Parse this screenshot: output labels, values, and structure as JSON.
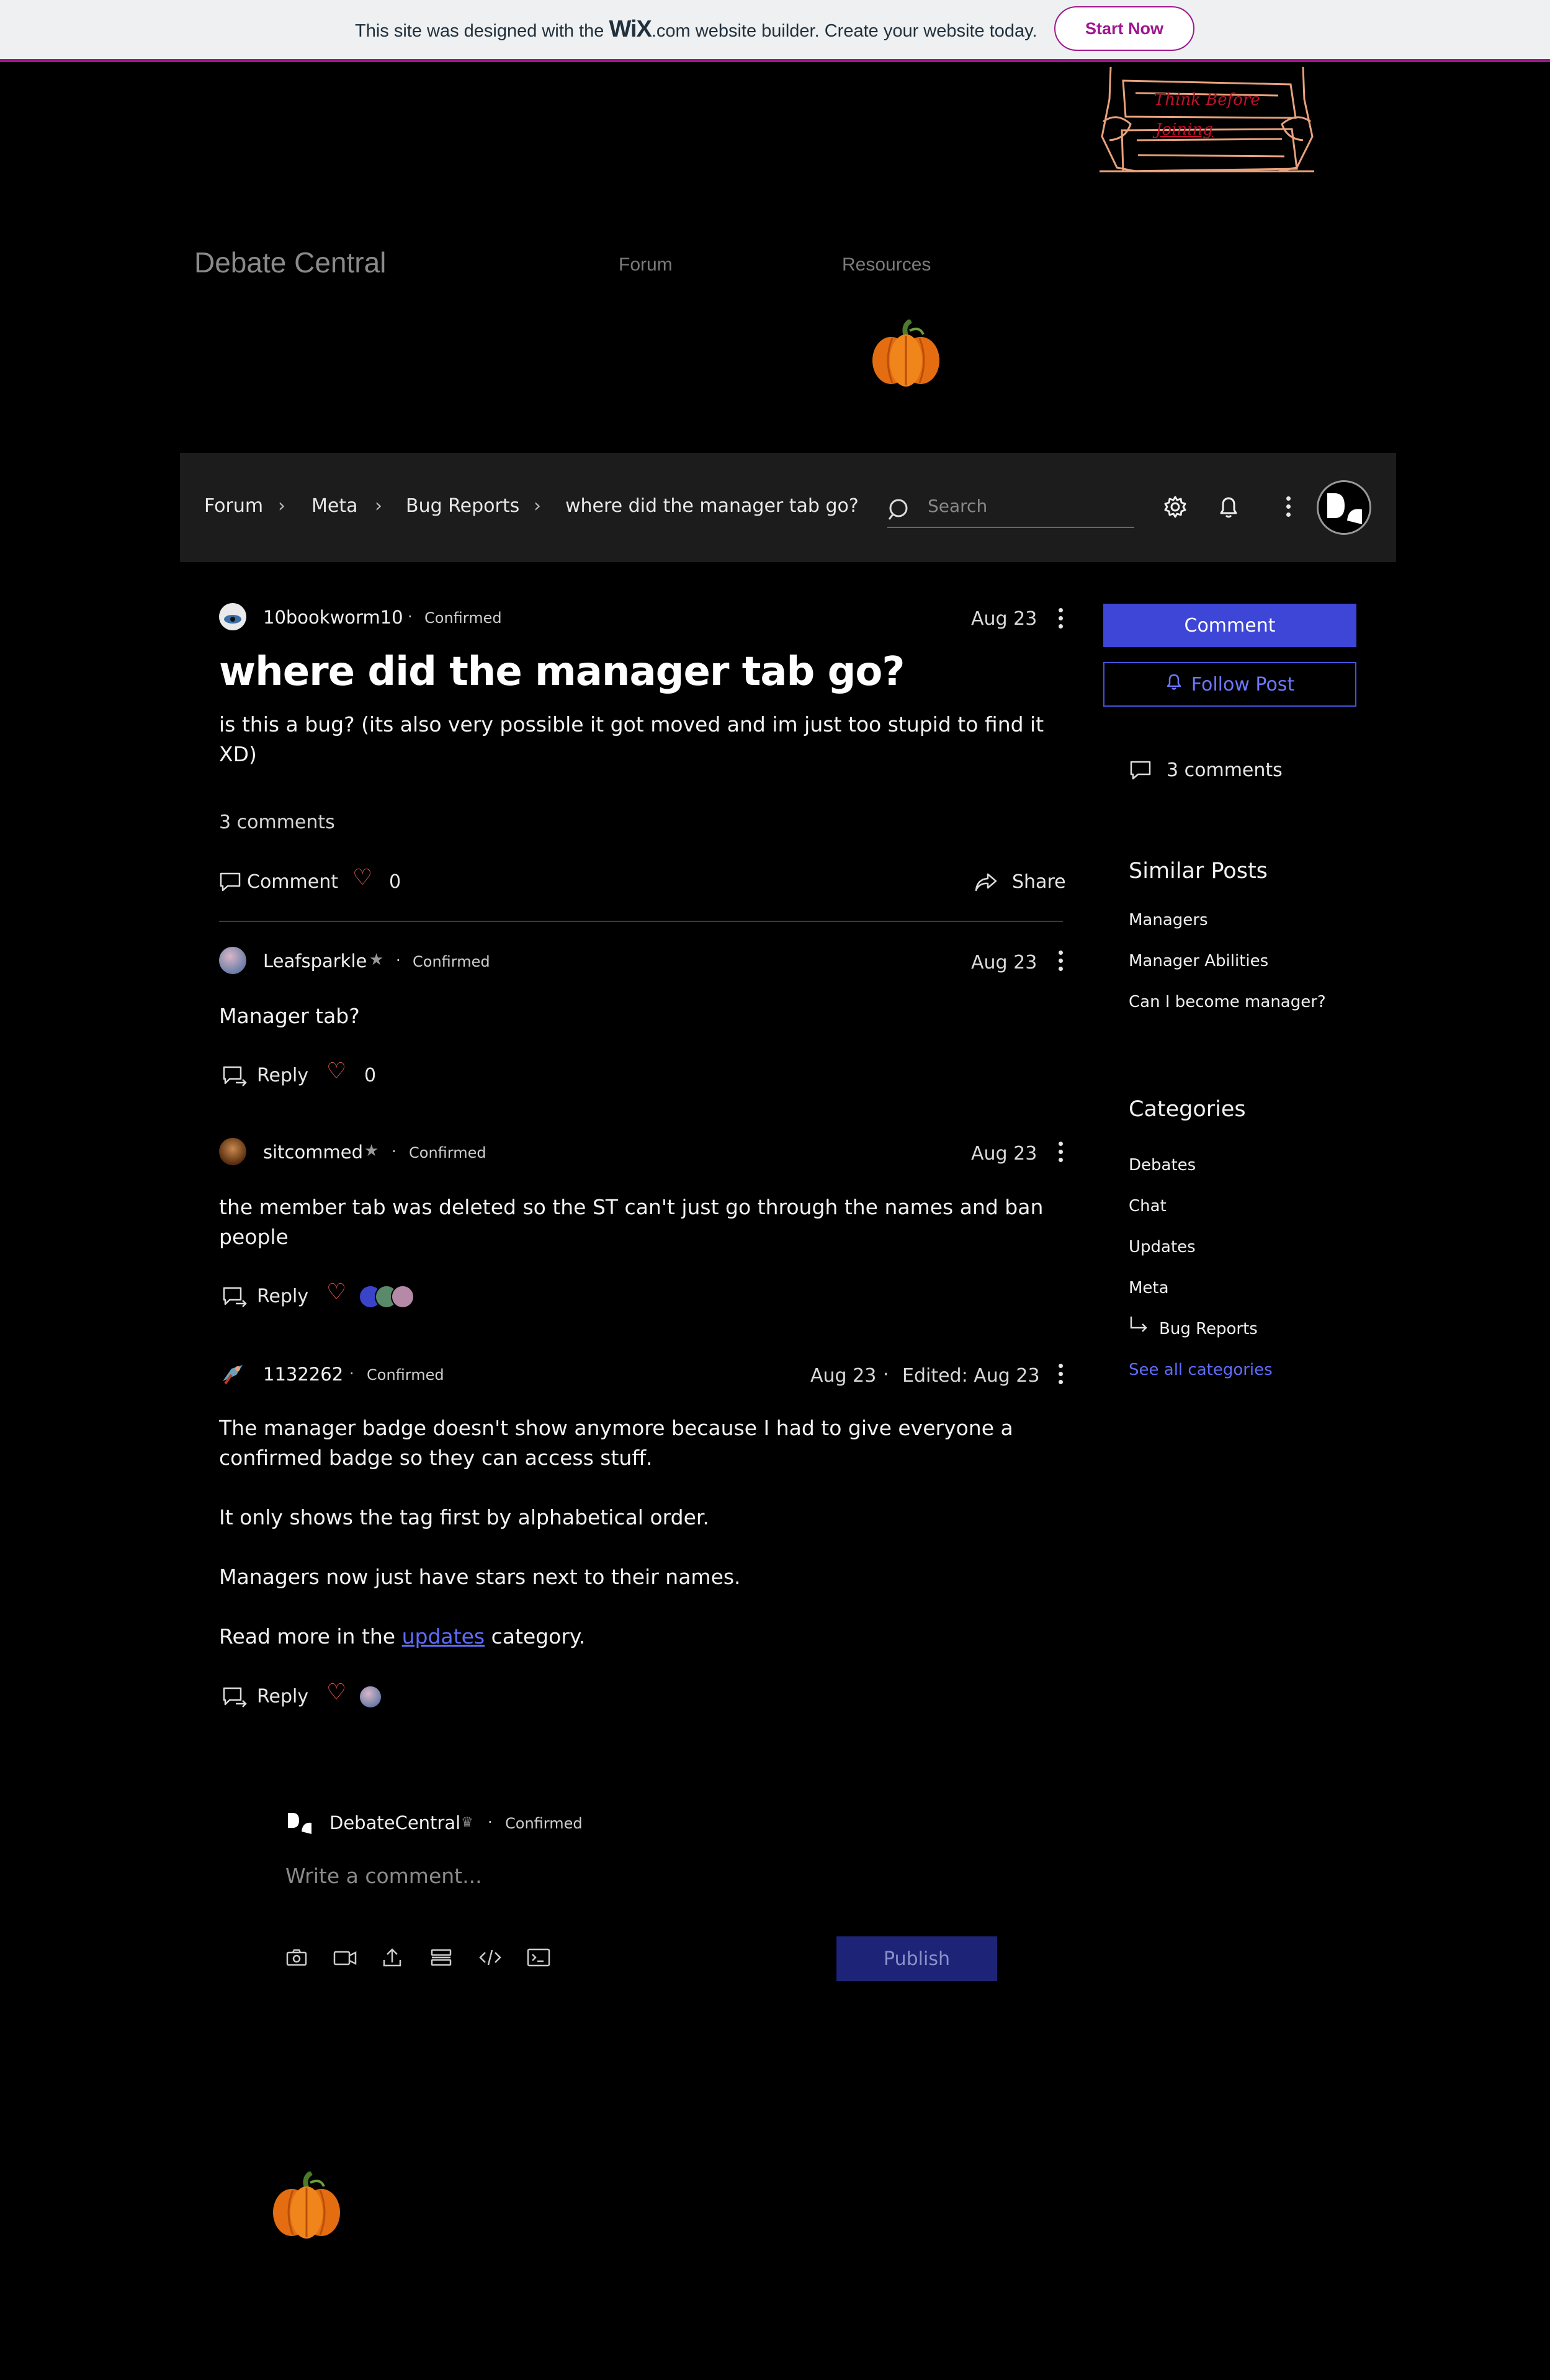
{
  "wix_banner": {
    "text_before": "This site was designed with the",
    "wix": "WiX",
    "text_after": ".com website builder. Create your website today.",
    "cta": "Start Now"
  },
  "header": {
    "logo_text_1": "Think Before",
    "logo_text_2": "Joining",
    "site_title": "Debate Central",
    "nav": [
      "Forum",
      "Resources"
    ]
  },
  "forum_bar": {
    "breadcrumbs": [
      "Forum",
      "Meta",
      "Bug Reports",
      "where did the manager tab go?"
    ],
    "search_placeholder": "Search"
  },
  "post": {
    "author": "10bookworm10",
    "badge": "Confirmed",
    "date": "Aug 23",
    "title": "where did the manager tab go?",
    "body": "is this a bug? (its also very possible it got moved and im just too stupid to find it XD)",
    "comments_count": "3 comments",
    "comment_label": "Comment",
    "likes": "0",
    "share_label": "Share"
  },
  "comments": [
    {
      "author": "Leafsparkle",
      "badge": "Confirmed",
      "date": "Aug 23",
      "body": "Manager tab?",
      "reply_label": "Reply",
      "likes": "0"
    },
    {
      "author": "sitcommed",
      "badge": "Confirmed",
      "date": "Aug 23",
      "body": "the member tab was deleted so the ST can't just go through the names and ban people",
      "reply_label": "Reply"
    },
    {
      "author": "1132262",
      "badge": "Confirmed",
      "date": "Aug 23",
      "edited": "Edited: Aug 23",
      "paragraphs": [
        "The manager badge doesn't show anymore because I had to give everyone a confirmed badge so they can access stuff.",
        "It only shows the tag first by alphabetical order.",
        "Managers now just have stars next to their names."
      ],
      "read_more_prefix": "Read more in the",
      "read_more_link": "updates",
      "read_more_suffix": "category.",
      "reply_label": "Reply"
    }
  ],
  "composer": {
    "author": "DebateCentral",
    "badge": "Confirmed",
    "placeholder": "Write a comment...",
    "publish": "Publish"
  },
  "sidebar": {
    "comment_btn": "Comment",
    "follow_btn": "Follow Post",
    "comments_count": "3 comments",
    "similar_title": "Similar Posts",
    "similar": [
      "Managers",
      "Manager Abilities",
      "Can I become manager?"
    ],
    "categories_title": "Categories",
    "categories": [
      "Debates",
      "Chat",
      "Updates",
      "Meta"
    ],
    "sub_category": "Bug Reports",
    "see_all": "See all categories"
  },
  "colors": {
    "accent": "#3d46d6",
    "link": "#5f6cff",
    "wix_purple": "#a0168f",
    "heart": "#e2574c"
  }
}
